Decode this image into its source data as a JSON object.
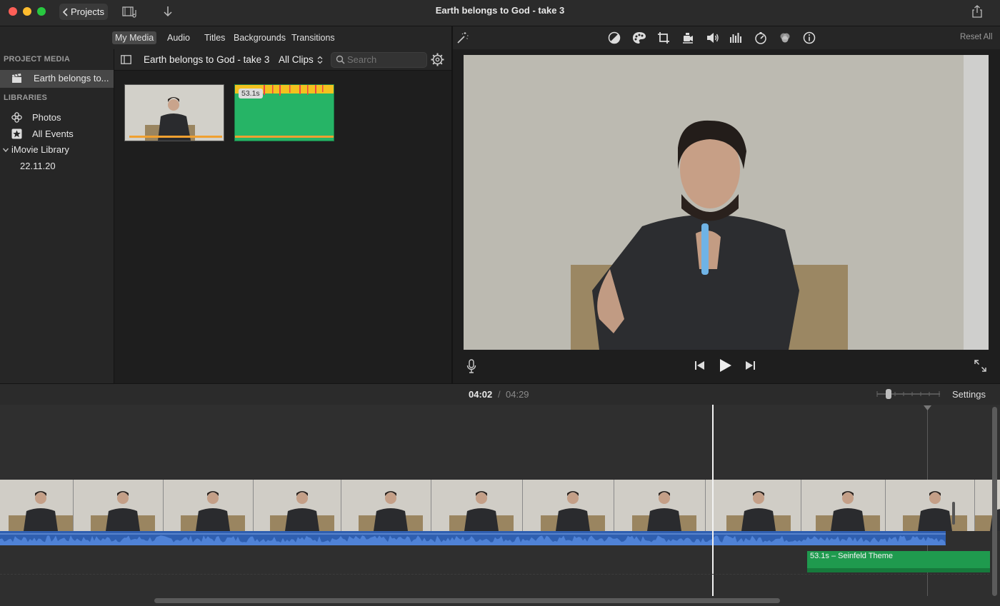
{
  "window": {
    "title": "Earth belongs to God - take 3",
    "projects_label": "Projects"
  },
  "browser_tabs": [
    "My Media",
    "Audio",
    "Titles",
    "Backgrounds",
    "Transitions"
  ],
  "active_tab": "My Media",
  "inspector": {
    "reset_all_label": "Reset All",
    "tools": [
      "magic-wand-icon",
      "color-balance-icon",
      "color-correction-icon",
      "crop-icon",
      "stabilization-icon",
      "volume-icon",
      "noise-reduction-icon",
      "speed-icon",
      "clip-filter-icon",
      "info-icon"
    ]
  },
  "sidebar": {
    "project_media_heading": "PROJECT MEDIA",
    "project_item": "Earth belongs to...",
    "libraries_heading": "LIBRARIES",
    "items": [
      {
        "label": "Photos",
        "icon": "photos-icon"
      },
      {
        "label": "All Events",
        "icon": "star-icon"
      },
      {
        "label": "iMovie Library",
        "icon": "disclosure-icon"
      },
      {
        "label": "22.11.20",
        "icon": ""
      }
    ]
  },
  "browser": {
    "title": "Earth belongs to God - take 3",
    "filter_label": "All Clips",
    "search_placeholder": "Search",
    "clips": [
      {
        "type": "video",
        "badge": ""
      },
      {
        "type": "audio",
        "badge": "53.1s"
      }
    ]
  },
  "viewer": {
    "current_time": "04:02",
    "separator": "/",
    "total_time": "04:29"
  },
  "timeline": {
    "settings_label": "Settings",
    "music_clip_label": "53.1s – Seinfeld Theme"
  },
  "colors": {
    "accent_orange": "#f0a030",
    "audio_blue": "#2f5fb0",
    "music_green": "#1f9a4e"
  }
}
